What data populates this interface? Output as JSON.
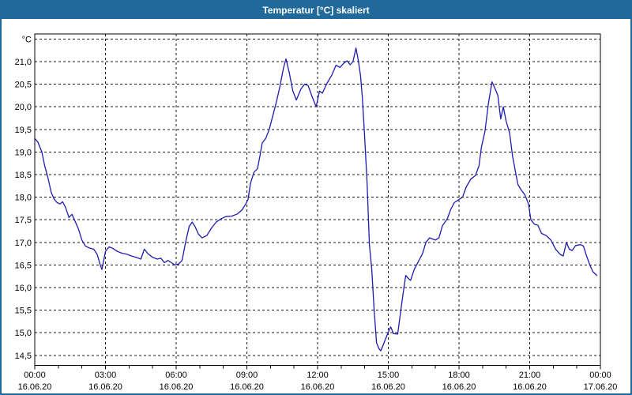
{
  "window": {
    "title": "Temperatur [°C] skaliert",
    "titlebar_color": "#1f699b",
    "border_color": "#1f699b",
    "background_color": "#ffffff"
  },
  "chart_data": {
    "type": "line",
    "title": "Temperatur [°C] skaliert",
    "unit_label": "°C",
    "xlabel": "",
    "ylabel": "°C",
    "line_color": "#1c1cb0",
    "grid_color": "#1a1a1a",
    "grid_style": "dashed",
    "legend_position": "none",
    "xlim_hours": [
      0,
      24
    ],
    "ylim": [
      14.5,
      21.5
    ],
    "x_ticks": [
      {
        "hour": 0,
        "time": "00:00",
        "date": "16.06.20"
      },
      {
        "hour": 3,
        "time": "03:00",
        "date": "16.06.20"
      },
      {
        "hour": 6,
        "time": "06:00",
        "date": "16.06.20"
      },
      {
        "hour": 9,
        "time": "09:00",
        "date": "16.06.20"
      },
      {
        "hour": 12,
        "time": "12:00",
        "date": "16.06.20"
      },
      {
        "hour": 15,
        "time": "15:00",
        "date": "16.06.20"
      },
      {
        "hour": 18,
        "time": "18:00",
        "date": "16.06.20"
      },
      {
        "hour": 21,
        "time": "21:00",
        "date": "16.06.20"
      },
      {
        "hour": 24,
        "time": "00:00",
        "date": "17.06.20"
      }
    ],
    "x_minor_tick_hours": 1,
    "y_ticks": [
      {
        "value": 21.5,
        "label": "°C"
      },
      {
        "value": 21.0,
        "label": "21,0"
      },
      {
        "value": 20.5,
        "label": "20,5"
      },
      {
        "value": 20.0,
        "label": "20,0"
      },
      {
        "value": 19.5,
        "label": "19,5"
      },
      {
        "value": 19.0,
        "label": "19,0"
      },
      {
        "value": 18.5,
        "label": "18,5"
      },
      {
        "value": 18.0,
        "label": "18,0"
      },
      {
        "value": 17.5,
        "label": "17,5"
      },
      {
        "value": 17.0,
        "label": "17,0"
      },
      {
        "value": 16.5,
        "label": "16,5"
      },
      {
        "value": 16.0,
        "label": "16,0"
      },
      {
        "value": 15.5,
        "label": "15,5"
      },
      {
        "value": 15.0,
        "label": "15,0"
      },
      {
        "value": 14.5,
        "label": "14,5"
      }
    ],
    "series": [
      {
        "name": "Temperatur",
        "points": [
          [
            0,
            19.3
          ],
          [
            0.13,
            19.22
          ],
          [
            0.3,
            19.0
          ],
          [
            0.42,
            18.7
          ],
          [
            0.55,
            18.45
          ],
          [
            0.7,
            18.1
          ],
          [
            0.82,
            17.96
          ],
          [
            0.95,
            17.88
          ],
          [
            1.08,
            17.85
          ],
          [
            1.18,
            17.9
          ],
          [
            1.3,
            17.78
          ],
          [
            1.45,
            17.55
          ],
          [
            1.58,
            17.62
          ],
          [
            1.7,
            17.48
          ],
          [
            1.85,
            17.3
          ],
          [
            2.0,
            17.05
          ],
          [
            2.15,
            16.92
          ],
          [
            2.3,
            16.88
          ],
          [
            2.5,
            16.85
          ],
          [
            2.65,
            16.73
          ],
          [
            2.78,
            16.5
          ],
          [
            2.85,
            16.4
          ],
          [
            3.0,
            16.8
          ],
          [
            3.15,
            16.9
          ],
          [
            3.3,
            16.87
          ],
          [
            3.5,
            16.8
          ],
          [
            3.7,
            16.76
          ],
          [
            3.9,
            16.74
          ],
          [
            4.1,
            16.7
          ],
          [
            4.3,
            16.67
          ],
          [
            4.5,
            16.63
          ],
          [
            4.65,
            16.85
          ],
          [
            4.8,
            16.75
          ],
          [
            5.0,
            16.67
          ],
          [
            5.2,
            16.63
          ],
          [
            5.35,
            16.65
          ],
          [
            5.5,
            16.55
          ],
          [
            5.65,
            16.6
          ],
          [
            5.8,
            16.55
          ],
          [
            5.95,
            16.5
          ],
          [
            6.1,
            16.52
          ],
          [
            6.25,
            16.6
          ],
          [
            6.4,
            17.0
          ],
          [
            6.55,
            17.35
          ],
          [
            6.68,
            17.45
          ],
          [
            6.8,
            17.35
          ],
          [
            6.95,
            17.18
          ],
          [
            7.1,
            17.1
          ],
          [
            7.3,
            17.15
          ],
          [
            7.5,
            17.32
          ],
          [
            7.7,
            17.45
          ],
          [
            7.9,
            17.52
          ],
          [
            8.1,
            17.57
          ],
          [
            8.35,
            17.58
          ],
          [
            8.6,
            17.63
          ],
          [
            8.8,
            17.72
          ],
          [
            8.95,
            17.85
          ],
          [
            9.05,
            17.95
          ],
          [
            9.15,
            18.3
          ],
          [
            9.3,
            18.55
          ],
          [
            9.45,
            18.63
          ],
          [
            9.55,
            18.9
          ],
          [
            9.65,
            19.2
          ],
          [
            9.8,
            19.3
          ],
          [
            9.95,
            19.5
          ],
          [
            10.1,
            19.8
          ],
          [
            10.25,
            20.1
          ],
          [
            10.4,
            20.45
          ],
          [
            10.55,
            20.85
          ],
          [
            10.66,
            21.06
          ],
          [
            10.8,
            20.75
          ],
          [
            10.95,
            20.35
          ],
          [
            11.1,
            20.15
          ],
          [
            11.3,
            20.4
          ],
          [
            11.45,
            20.5
          ],
          [
            11.6,
            20.47
          ],
          [
            11.75,
            20.25
          ],
          [
            11.94,
            20.0
          ],
          [
            12.08,
            20.35
          ],
          [
            12.2,
            20.3
          ],
          [
            12.4,
            20.52
          ],
          [
            12.6,
            20.7
          ],
          [
            12.78,
            20.92
          ],
          [
            12.95,
            20.87
          ],
          [
            13.1,
            20.96
          ],
          [
            13.25,
            21.02
          ],
          [
            13.38,
            20.93
          ],
          [
            13.5,
            21.0
          ],
          [
            13.63,
            21.3
          ],
          [
            13.72,
            21.05
          ],
          [
            13.82,
            20.7
          ],
          [
            13.9,
            20.2
          ],
          [
            14.0,
            19.3
          ],
          [
            14.1,
            18.3
          ],
          [
            14.2,
            16.95
          ],
          [
            14.3,
            16.4
          ],
          [
            14.4,
            15.5
          ],
          [
            14.5,
            14.78
          ],
          [
            14.6,
            14.65
          ],
          [
            14.68,
            14.6
          ],
          [
            14.8,
            14.75
          ],
          [
            14.95,
            14.95
          ],
          [
            15.1,
            15.13
          ],
          [
            15.22,
            14.98
          ],
          [
            15.4,
            14.97
          ],
          [
            15.52,
            15.45
          ],
          [
            15.65,
            15.95
          ],
          [
            15.74,
            16.27
          ],
          [
            15.85,
            16.2
          ],
          [
            15.95,
            16.16
          ],
          [
            16.1,
            16.4
          ],
          [
            16.3,
            16.6
          ],
          [
            16.45,
            16.75
          ],
          [
            16.6,
            17.0
          ],
          [
            16.75,
            17.1
          ],
          [
            17.0,
            17.05
          ],
          [
            17.15,
            17.1
          ],
          [
            17.3,
            17.37
          ],
          [
            17.5,
            17.52
          ],
          [
            17.65,
            17.73
          ],
          [
            17.8,
            17.88
          ],
          [
            18.0,
            17.95
          ],
          [
            18.15,
            18.0
          ],
          [
            18.3,
            18.22
          ],
          [
            18.5,
            18.4
          ],
          [
            18.7,
            18.48
          ],
          [
            18.85,
            18.7
          ],
          [
            18.95,
            19.1
          ],
          [
            19.1,
            19.45
          ],
          [
            19.25,
            20.08
          ],
          [
            19.4,
            20.55
          ],
          [
            19.55,
            20.38
          ],
          [
            19.65,
            20.25
          ],
          [
            19.77,
            19.73
          ],
          [
            19.88,
            20.0
          ],
          [
            20.0,
            19.68
          ],
          [
            20.15,
            19.42
          ],
          [
            20.27,
            18.92
          ],
          [
            20.4,
            18.55
          ],
          [
            20.5,
            18.28
          ],
          [
            20.65,
            18.15
          ],
          [
            20.8,
            18.05
          ],
          [
            20.95,
            17.85
          ],
          [
            21.05,
            17.5
          ],
          [
            21.2,
            17.4
          ],
          [
            21.35,
            17.38
          ],
          [
            21.5,
            17.2
          ],
          [
            21.7,
            17.15
          ],
          [
            21.9,
            17.05
          ],
          [
            22.1,
            16.85
          ],
          [
            22.3,
            16.73
          ],
          [
            22.42,
            16.7
          ],
          [
            22.56,
            17.0
          ],
          [
            22.68,
            16.85
          ],
          [
            22.8,
            16.82
          ],
          [
            22.95,
            16.93
          ],
          [
            23.15,
            16.95
          ],
          [
            23.28,
            16.92
          ],
          [
            23.4,
            16.72
          ],
          [
            23.55,
            16.5
          ],
          [
            23.68,
            16.35
          ],
          [
            23.85,
            16.27
          ]
        ]
      }
    ]
  }
}
